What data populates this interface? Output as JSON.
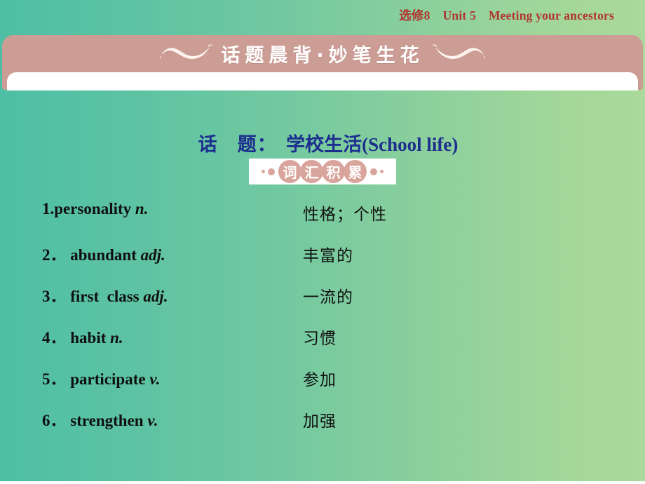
{
  "header": {
    "book": "选修8",
    "unit": "Unit 5",
    "lesson": "Meeting your ancestors"
  },
  "banner": {
    "title": "话题晨背·妙笔生花",
    "ornament_left": "wave-flourish-ornament",
    "ornament_right": "wave-flourish-ornament"
  },
  "topic": {
    "label": "话　题：",
    "value": "学校生活(School life)"
  },
  "vocab_badge": {
    "characters": [
      "词",
      "汇",
      "积",
      "累"
    ],
    "label": "词汇积累"
  },
  "words": [
    {
      "num": "1.",
      "term": "personality ",
      "pos": "n.",
      "meaning": "性格；个性"
    },
    {
      "num": "2．",
      "term": " abundant ",
      "pos": "adj.",
      "meaning": "丰富的"
    },
    {
      "num": "3．",
      "term": " first  class ",
      "pos": "adj.",
      "meaning": "一流的"
    },
    {
      "num": "4．",
      "term": " habit ",
      "pos": "n.",
      "meaning": "习惯"
    },
    {
      "num": "5．",
      "term": " participate ",
      "pos": "v.",
      "meaning": "参加"
    },
    {
      "num": "6．",
      "term": " strengthen ",
      "pos": "v.",
      "meaning": "加强"
    }
  ],
  "colors": {
    "header_text": "#b0352f",
    "banner_pink": "#cb9d94",
    "topic_blue": "#1c2f8e",
    "bg_left": "#4ebfa4",
    "bg_right": "#aad99b"
  }
}
